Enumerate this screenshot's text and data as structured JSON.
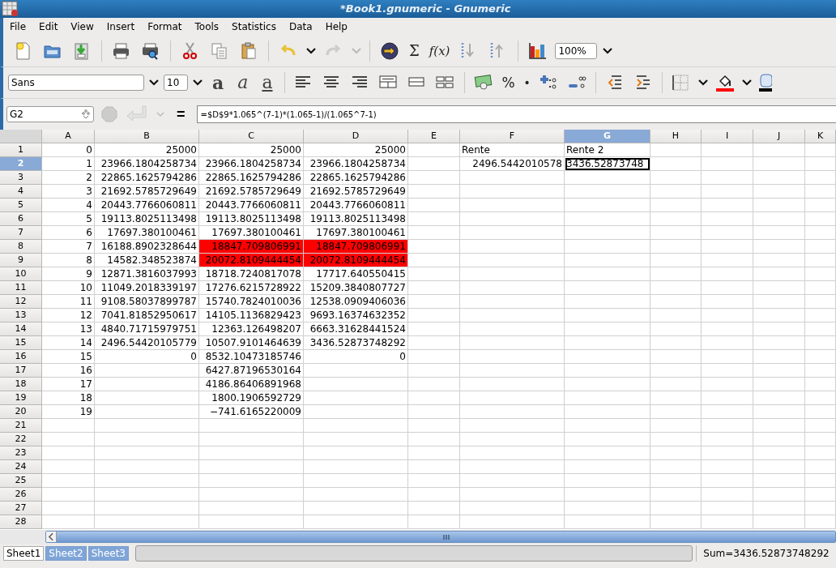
{
  "window": {
    "title": "*Book1.gnumeric - Gnumeric"
  },
  "menu": [
    "File",
    "Edit",
    "View",
    "Insert",
    "Format",
    "Tools",
    "Statistics",
    "Data",
    "Help"
  ],
  "toolbar": {
    "sum_label": "Σ",
    "function_label": "f(x)",
    "zoom": "100%"
  },
  "format_bar": {
    "font": "Sans",
    "size": "10",
    "style_buttons": [
      {
        "label": "a",
        "kind": "bold"
      },
      {
        "label": "a",
        "kind": "italic"
      },
      {
        "label": "a",
        "kind": "underline"
      }
    ],
    "percent_label": "%",
    "thousands_label": "·"
  },
  "formula_bar": {
    "cell_ref": "G2",
    "equals": "=",
    "formula": "=$D$9*1.065^(7-1)*(1.065-1)/(1.065^7-1)"
  },
  "sheet": {
    "columns": [
      {
        "label": "A",
        "selected": false
      },
      {
        "label": "B",
        "selected": false
      },
      {
        "label": "C",
        "selected": false
      },
      {
        "label": "D",
        "selected": false
      },
      {
        "label": "E",
        "selected": false
      },
      {
        "label": "F",
        "selected": false
      },
      {
        "label": "G",
        "selected": true
      },
      {
        "label": "H",
        "selected": false
      },
      {
        "label": "I",
        "selected": false
      },
      {
        "label": "J",
        "selected": false
      },
      {
        "label": "K",
        "selected": false
      }
    ],
    "rows": [
      {
        "header": "1",
        "selected": false,
        "cells": [
          {
            "text": "0",
            "kind": "number",
            "highlighted": false,
            "selected": false
          },
          {
            "text": "25000",
            "kind": "number",
            "highlighted": false,
            "selected": false
          },
          {
            "text": "25000",
            "kind": "number",
            "highlighted": false,
            "selected": false
          },
          {
            "text": "25000",
            "kind": "number",
            "highlighted": false,
            "selected": false
          },
          null,
          {
            "text": "Rente",
            "kind": "text",
            "highlighted": false,
            "selected": false
          },
          {
            "text": "Rente 2",
            "kind": "text",
            "highlighted": false,
            "selected": false
          }
        ]
      },
      {
        "header": "2",
        "selected": true,
        "cells": [
          {
            "text": "1",
            "kind": "number",
            "highlighted": false,
            "selected": false
          },
          {
            "text": "23966.1804258734",
            "kind": "number",
            "highlighted": false,
            "selected": false
          },
          {
            "text": "23966.1804258734",
            "kind": "number",
            "highlighted": false,
            "selected": false
          },
          {
            "text": "23966.1804258734",
            "kind": "number",
            "highlighted": false,
            "selected": false
          },
          null,
          {
            "text": "2496.5442010578",
            "kind": "number",
            "highlighted": false,
            "selected": false
          },
          {
            "text": "3436.52873748",
            "kind": "number",
            "highlighted": false,
            "selected": true
          }
        ]
      },
      {
        "header": "3",
        "selected": false,
        "cells": [
          {
            "text": "2",
            "kind": "number",
            "highlighted": false,
            "selected": false
          },
          {
            "text": "22865.1625794286",
            "kind": "number",
            "highlighted": false,
            "selected": false
          },
          {
            "text": "22865.1625794286",
            "kind": "number",
            "highlighted": false,
            "selected": false
          },
          {
            "text": "22865.1625794286",
            "kind": "number",
            "highlighted": false,
            "selected": false
          }
        ]
      },
      {
        "header": "4",
        "selected": false,
        "cells": [
          {
            "text": "3",
            "kind": "number",
            "highlighted": false,
            "selected": false
          },
          {
            "text": "21692.5785729649",
            "kind": "number",
            "highlighted": false,
            "selected": false
          },
          {
            "text": "21692.5785729649",
            "kind": "number",
            "highlighted": false,
            "selected": false
          },
          {
            "text": "21692.5785729649",
            "kind": "number",
            "highlighted": false,
            "selected": false
          }
        ]
      },
      {
        "header": "5",
        "selected": false,
        "cells": [
          {
            "text": "4",
            "kind": "number",
            "highlighted": false,
            "selected": false
          },
          {
            "text": "20443.7766060811",
            "kind": "number",
            "highlighted": false,
            "selected": false
          },
          {
            "text": "20443.7766060811",
            "kind": "number",
            "highlighted": false,
            "selected": false
          },
          {
            "text": "20443.7766060811",
            "kind": "number",
            "highlighted": false,
            "selected": false
          }
        ]
      },
      {
        "header": "6",
        "selected": false,
        "cells": [
          {
            "text": "5",
            "kind": "number",
            "highlighted": false,
            "selected": false
          },
          {
            "text": "19113.8025113498",
            "kind": "number",
            "highlighted": false,
            "selected": false
          },
          {
            "text": "19113.8025113498",
            "kind": "number",
            "highlighted": false,
            "selected": false
          },
          {
            "text": "19113.8025113498",
            "kind": "number",
            "highlighted": false,
            "selected": false
          }
        ]
      },
      {
        "header": "7",
        "selected": false,
        "cells": [
          {
            "text": "6",
            "kind": "number",
            "highlighted": false,
            "selected": false
          },
          {
            "text": "17697.380100461",
            "kind": "number",
            "highlighted": false,
            "selected": false
          },
          {
            "text": "17697.380100461",
            "kind": "number",
            "highlighted": false,
            "selected": false
          },
          {
            "text": "17697.380100461",
            "kind": "number",
            "highlighted": false,
            "selected": false
          }
        ]
      },
      {
        "header": "8",
        "selected": false,
        "cells": [
          {
            "text": "7",
            "kind": "number",
            "highlighted": false,
            "selected": false
          },
          {
            "text": "16188.8902328644",
            "kind": "number",
            "highlighted": false,
            "selected": false
          },
          {
            "text": "18847.709806991",
            "kind": "number",
            "highlighted": true,
            "selected": false
          },
          {
            "text": "18847.709806991",
            "kind": "number",
            "highlighted": true,
            "selected": false
          }
        ]
      },
      {
        "header": "9",
        "selected": false,
        "cells": [
          {
            "text": "8",
            "kind": "number",
            "highlighted": false,
            "selected": false
          },
          {
            "text": "14582.348523874",
            "kind": "number",
            "highlighted": false,
            "selected": false
          },
          {
            "text": "20072.8109444454",
            "kind": "number",
            "highlighted": true,
            "selected": false
          },
          {
            "text": "20072.8109444454",
            "kind": "number",
            "highlighted": true,
            "selected": false
          }
        ]
      },
      {
        "header": "10",
        "selected": false,
        "cells": [
          {
            "text": "9",
            "kind": "number",
            "highlighted": false,
            "selected": false
          },
          {
            "text": "12871.3816037993",
            "kind": "number",
            "highlighted": false,
            "selected": false
          },
          {
            "text": "18718.7240817078",
            "kind": "number",
            "highlighted": false,
            "selected": false
          },
          {
            "text": "17717.640550415",
            "kind": "number",
            "highlighted": false,
            "selected": false
          }
        ]
      },
      {
        "header": "11",
        "selected": false,
        "cells": [
          {
            "text": "10",
            "kind": "number",
            "highlighted": false,
            "selected": false
          },
          {
            "text": "11049.2018339197",
            "kind": "number",
            "highlighted": false,
            "selected": false
          },
          {
            "text": "17276.6215728922",
            "kind": "number",
            "highlighted": false,
            "selected": false
          },
          {
            "text": "15209.3840807727",
            "kind": "number",
            "highlighted": false,
            "selected": false
          }
        ]
      },
      {
        "header": "12",
        "selected": false,
        "cells": [
          {
            "text": "11",
            "kind": "number",
            "highlighted": false,
            "selected": false
          },
          {
            "text": "9108.58037899787",
            "kind": "number",
            "highlighted": false,
            "selected": false
          },
          {
            "text": "15740.7824010036",
            "kind": "number",
            "highlighted": false,
            "selected": false
          },
          {
            "text": "12538.0909406036",
            "kind": "number",
            "highlighted": false,
            "selected": false
          }
        ]
      },
      {
        "header": "13",
        "selected": false,
        "cells": [
          {
            "text": "12",
            "kind": "number",
            "highlighted": false,
            "selected": false
          },
          {
            "text": "7041.81852950617",
            "kind": "number",
            "highlighted": false,
            "selected": false
          },
          {
            "text": "14105.1136829423",
            "kind": "number",
            "highlighted": false,
            "selected": false
          },
          {
            "text": "9693.16374632352",
            "kind": "number",
            "highlighted": false,
            "selected": false
          }
        ]
      },
      {
        "header": "14",
        "selected": false,
        "cells": [
          {
            "text": "13",
            "kind": "number",
            "highlighted": false,
            "selected": false
          },
          {
            "text": "4840.71715979751",
            "kind": "number",
            "highlighted": false,
            "selected": false
          },
          {
            "text": "12363.126498207",
            "kind": "number",
            "highlighted": false,
            "selected": false
          },
          {
            "text": "6663.31628441524",
            "kind": "number",
            "highlighted": false,
            "selected": false
          }
        ]
      },
      {
        "header": "15",
        "selected": false,
        "cells": [
          {
            "text": "14",
            "kind": "number",
            "highlighted": false,
            "selected": false
          },
          {
            "text": "2496.54420105779",
            "kind": "number",
            "highlighted": false,
            "selected": false
          },
          {
            "text": "10507.9101464639",
            "kind": "number",
            "highlighted": false,
            "selected": false
          },
          {
            "text": "3436.52873748292",
            "kind": "number",
            "highlighted": false,
            "selected": false
          }
        ]
      },
      {
        "header": "16",
        "selected": false,
        "cells": [
          {
            "text": "15",
            "kind": "number",
            "highlighted": false,
            "selected": false
          },
          {
            "text": "0",
            "kind": "number",
            "highlighted": false,
            "selected": false
          },
          {
            "text": "8532.10473185746",
            "kind": "number",
            "highlighted": false,
            "selected": false
          },
          {
            "text": "0",
            "kind": "number",
            "highlighted": false,
            "selected": false
          }
        ]
      },
      {
        "header": "17",
        "selected": false,
        "cells": [
          {
            "text": "16",
            "kind": "number",
            "highlighted": false,
            "selected": false
          },
          null,
          {
            "text": "6427.87196530164",
            "kind": "number",
            "highlighted": false,
            "selected": false
          }
        ]
      },
      {
        "header": "18",
        "selected": false,
        "cells": [
          {
            "text": "17",
            "kind": "number",
            "highlighted": false,
            "selected": false
          },
          null,
          {
            "text": "4186.86406891968",
            "kind": "number",
            "highlighted": false,
            "selected": false
          }
        ]
      },
      {
        "header": "19",
        "selected": false,
        "cells": [
          {
            "text": "18",
            "kind": "number",
            "highlighted": false,
            "selected": false
          },
          null,
          {
            "text": "1800.1906592729",
            "kind": "number",
            "highlighted": false,
            "selected": false
          }
        ]
      },
      {
        "header": "20",
        "selected": false,
        "cells": [
          {
            "text": "19",
            "kind": "number",
            "highlighted": false,
            "selected": false
          },
          null,
          {
            "text": "−741.6165220009",
            "kind": "number",
            "highlighted": false,
            "selected": false
          }
        ]
      },
      {
        "header": "21",
        "selected": false
      },
      {
        "header": "22",
        "selected": false
      },
      {
        "header": "23",
        "selected": false
      },
      {
        "header": "24",
        "selected": false
      },
      {
        "header": "25",
        "selected": false
      },
      {
        "header": "26",
        "selected": false
      },
      {
        "header": "27",
        "selected": false
      },
      {
        "header": "28",
        "selected": false
      }
    ]
  },
  "sheet_tabs": [
    {
      "label": "Sheet1",
      "selected": true
    },
    {
      "label": "Sheet2",
      "selected": false
    },
    {
      "label": "Sheet3",
      "selected": false
    }
  ],
  "status_bar": {
    "sum": "Sum=3436.52873748292"
  }
}
